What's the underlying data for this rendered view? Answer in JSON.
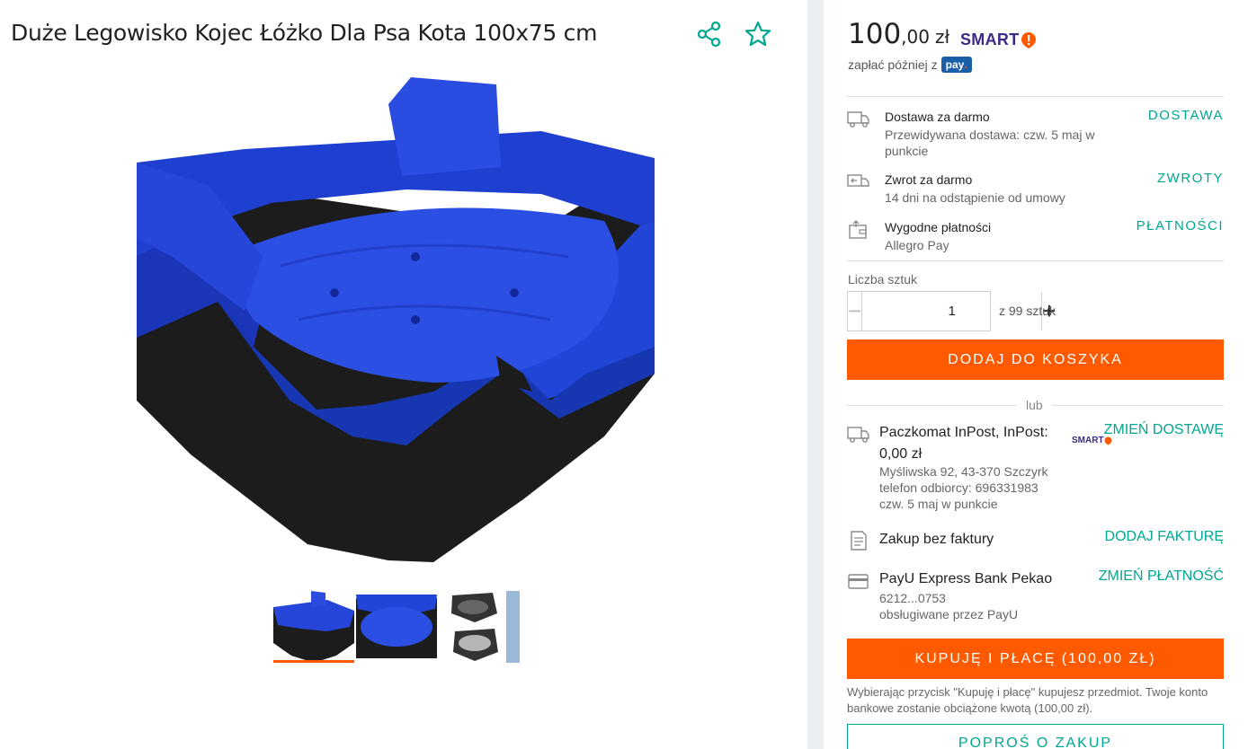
{
  "product": {
    "title": "Duże Legowisko Kojec Łóżko Dla Psa Kota 100x75 cm"
  },
  "icons": {
    "share": "share-icon",
    "favorite": "star-icon"
  },
  "colors": {
    "accent_orange": "#ff5a00",
    "accent_teal": "#00a790",
    "smart_purple": "#3d2a87",
    "bed_blue": "#1f3fd1",
    "bed_black": "#1c1c1c"
  },
  "price": {
    "integer": "100",
    "decimal": ",00",
    "currency": "zł",
    "smart": "SMART",
    "pay_later": "zapłać później z",
    "pay_badge_main": "pay",
    "pay_badge_dot": "."
  },
  "info": [
    {
      "title": "Dostawa za darmo",
      "sub": "Przewidywana dostawa: czw. 5 maj w punkcie",
      "link": "DOSTAWA"
    },
    {
      "title": "Zwrot za darmo",
      "sub": "14 dni na odstąpienie od umowy",
      "link": "ZWROTY"
    },
    {
      "title": "Wygodne płatności",
      "sub": "Allegro Pay",
      "link": "PŁATNOŚCI"
    }
  ],
  "quantity": {
    "label": "Liczba sztuk",
    "value": "1",
    "minus": "−",
    "plus": "+",
    "of": "z 99 sztuk"
  },
  "cart_button": "DODAJ DO KOSZYKA",
  "or_text": "lub",
  "delivery": {
    "title": "Paczkomat InPost, InPost:",
    "price": "0,00 zł",
    "address": "Myśliwska 92, 43-370 Szczyrk",
    "phone": "telefon odbiorcy: 696331983",
    "date": "czw. 5 maj w punkcie",
    "link": "ZMIEŃ DOSTAWĘ",
    "smart": "SMART"
  },
  "invoice": {
    "title": "Zakup bez faktury",
    "link": "DODAJ FAKTURĘ"
  },
  "payment": {
    "title": "PayU Express Bank Pekao",
    "card": "6212...0753",
    "provider": "obsługiwane przez PayU",
    "link": "ZMIEŃ PŁATNOŚĆ"
  },
  "buy_button": "KUPUJĘ I PŁACĘ (100,00 ZŁ)",
  "legal": "Wybierając przycisk \"Kupuję i płacę\" kupujesz przedmiot. Twoje konto bankowe zostanie obciążone kwotą (100,00 zł).",
  "ask_button": "POPROŚ O ZAKUP"
}
